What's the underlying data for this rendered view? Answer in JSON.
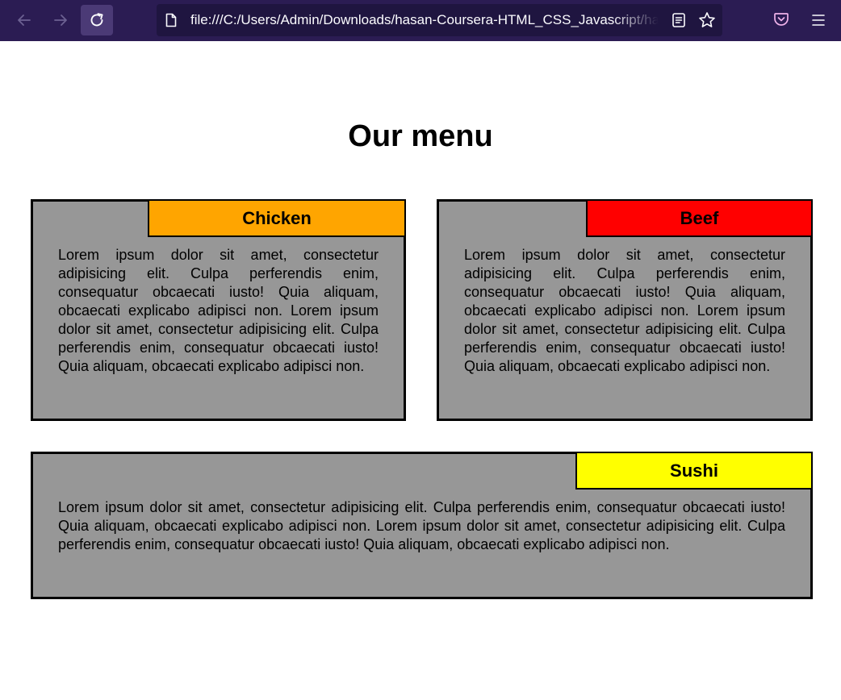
{
  "browser": {
    "url": "file:///C:/Users/Admin/Downloads/hasan-Coursera-HTML_CSS_Javascript/hasan-Coursera-HTML_CSS_Javascript/index.html",
    "icons": [
      "back-arrow-icon",
      "forward-arrow-icon",
      "reload-icon",
      "page-icon",
      "reader-view-icon",
      "bookmark-star-icon",
      "pocket-icon",
      "hamburger-menu-icon"
    ]
  },
  "page": {
    "title": "Our menu",
    "cards": [
      {
        "label": "Chicken",
        "color": "#ffa500",
        "text": "Lorem ipsum dolor sit amet, consectetur adipisicing elit. Culpa perferendis enim, consequatur obcaecati iusto! Quia aliquam, obcaecati explicabo adipisci non. Lorem ipsum dolor sit amet, consectetur adipisicing elit. Culpa perferendis enim, consequatur obcaecati iusto! Quia aliquam, obcaecati explicabo adipisci non."
      },
      {
        "label": "Beef",
        "color": "#ff0000",
        "text": "Lorem ipsum dolor sit amet, consectetur adipisicing elit. Culpa perferendis enim, consequatur obcaecati iusto! Quia aliquam, obcaecati explicabo adipisci non. Lorem ipsum dolor sit amet, consectetur adipisicing elit. Culpa perferendis enim, consequatur obcaecati iusto! Quia aliquam, obcaecati explicabo adipisci non."
      },
      {
        "label": "Sushi",
        "color": "#ffff00",
        "text": "Lorem ipsum dolor sit amet, consectetur adipisicing elit. Culpa perferendis enim, consequatur obcaecati iusto! Quia aliquam, obcaecati explicabo adipisci non. Lorem ipsum dolor sit amet, consectetur adipisicing elit. Culpa perferendis enim, consequatur obcaecati iusto! Quia aliquam, obcaecati explicabo adipisci non."
      }
    ],
    "card_background": "#979797"
  }
}
